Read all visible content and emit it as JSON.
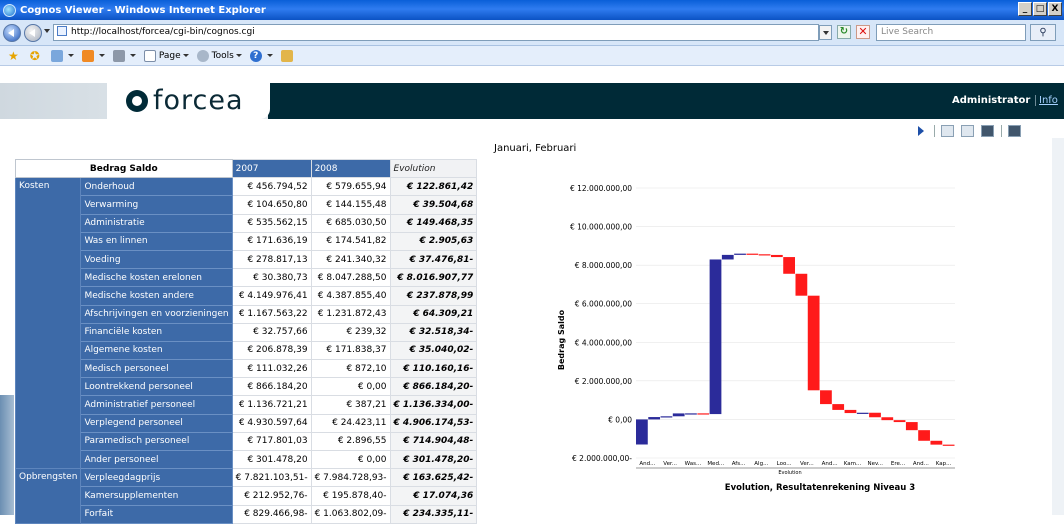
{
  "window": {
    "title": "Cognos Viewer - Windows Internet Explorer",
    "controls": [
      "_",
      "·",
      "X"
    ]
  },
  "addressbar": {
    "url": "http://localhost/forcea/cgi-bin/cognos.cgi",
    "search_placeholder": "Live Search"
  },
  "commandbar": {
    "page_label": "Page",
    "tools_label": "Tools"
  },
  "banner": {
    "logo_text": "forcea",
    "user": "Administrator",
    "info": "Info"
  },
  "report": {
    "period_title": "Januari, Februari",
    "table": {
      "corner": "Bedrag Saldo",
      "col_2007": "2007",
      "col_2008": "2008",
      "col_evolution": "Evolution",
      "groups": [
        {
          "name": "Kosten",
          "rows": [
            {
              "label": "Onderhoud",
              "v2007": "€ 456.794,52",
              "v2008": "€ 579.655,94",
              "evo": "€ 122.861,42"
            },
            {
              "label": "Verwarming",
              "v2007": "€ 104.650,80",
              "v2008": "€ 144.155,48",
              "evo": "€ 39.504,68"
            },
            {
              "label": "Administratie",
              "v2007": "€ 535.562,15",
              "v2008": "€ 685.030,50",
              "evo": "€ 149.468,35"
            },
            {
              "label": "Was en linnen",
              "v2007": "€ 171.636,19",
              "v2008": "€ 174.541,82",
              "evo": "€ 2.905,63"
            },
            {
              "label": "Voeding",
              "v2007": "€ 278.817,13",
              "v2008": "€ 241.340,32",
              "evo": "€ 37.476,81-"
            },
            {
              "label": "Medische kosten erelonen",
              "v2007": "€ 30.380,73",
              "v2008": "€ 8.047.288,50",
              "evo": "€ 8.016.907,77"
            },
            {
              "label": "Medische kosten andere",
              "v2007": "€ 4.149.976,41",
              "v2008": "€ 4.387.855,40",
              "evo": "€ 237.878,99"
            },
            {
              "label": "Afschrijvingen en voorzieningen",
              "v2007": "€ 1.167.563,22",
              "v2008": "€ 1.231.872,43",
              "evo": "€ 64.309,21"
            },
            {
              "label": "Financiële kosten",
              "v2007": "€ 32.757,66",
              "v2008": "€ 239,32",
              "evo": "€ 32.518,34-"
            },
            {
              "label": "Algemene kosten",
              "v2007": "€ 206.878,39",
              "v2008": "€ 171.838,37",
              "evo": "€ 35.040,02-"
            },
            {
              "label": "Medisch personeel",
              "v2007": "€ 111.032,26",
              "v2008": "€ 872,10",
              "evo": "€ 110.160,16-"
            },
            {
              "label": "Loontrekkend personeel",
              "v2007": "€ 866.184,20",
              "v2008": "€ 0,00",
              "evo": "€ 866.184,20-"
            },
            {
              "label": "Administratief personeel",
              "v2007": "€ 1.136.721,21",
              "v2008": "€ 387,21",
              "evo": "€ 1.136.334,00-"
            },
            {
              "label": "Verplegend personeel",
              "v2007": "€ 4.930.597,64",
              "v2008": "€ 24.423,11",
              "evo": "€ 4.906.174,53-"
            },
            {
              "label": "Paramedisch personeel",
              "v2007": "€ 717.801,03",
              "v2008": "€ 2.896,55",
              "evo": "€ 714.904,48-"
            },
            {
              "label": "Ander personeel",
              "v2007": "€ 301.478,20",
              "v2008": "€ 0,00",
              "evo": "€ 301.478,20-"
            }
          ]
        },
        {
          "name": "Opbrengsten",
          "rows": [
            {
              "label": "Verpleegdagprijs",
              "v2007": "€ 7.821.103,51-",
              "v2008": "€ 7.984.728,93-",
              "evo": "€ 163.625,42-"
            },
            {
              "label": "Kamersupplementen",
              "v2007": "€ 212.952,76-",
              "v2008": "€ 195.878,40-",
              "evo": "€ 17.074,36"
            },
            {
              "label": "Forfait",
              "v2007": "€ 829.466,98-",
              "v2008": "€ 1.063.802,09-",
              "evo": "€ 234.335,11-"
            }
          ]
        }
      ]
    }
  },
  "chart_data": {
    "type": "bar",
    "subtype": "waterfall",
    "title": "Evolution, Resultatenrekening Niveau 3",
    "ylabel": "Bedrag Saldo",
    "xlabel": "Evolution",
    "ylim": [
      -2000000,
      12000000
    ],
    "yticks": [
      "€ 2.000.000,00-",
      "€ 0,00",
      "€ 2.000.000,00",
      "€ 4.000.000,00",
      "€ 6.000.000,00",
      "€ 8.000.000,00",
      "€ 10.000.000,00",
      "€ 12.000.000,00"
    ],
    "ytick_values": [
      -2000000,
      0,
      2000000,
      4000000,
      6000000,
      8000000,
      10000000,
      12000000
    ],
    "categories": [
      "And...",
      "Ver...",
      "Was...",
      "Med...",
      "Afs...",
      "Alg...",
      "Loo...",
      "Ver...",
      "And...",
      "Kam...",
      "Nev...",
      "Ere...",
      "And...",
      "Kap..."
    ],
    "start_value": -1300000,
    "steps": [
      1300000,
      122861,
      39505,
      149468,
      2906,
      -37477,
      8016908,
      237879,
      64309,
      -32518,
      -35040,
      -110160,
      -866184,
      -1136334,
      -4906175,
      -714904,
      -301478,
      -163625,
      17074,
      -234335,
      -150000,
      -100000,
      -420000,
      -550000,
      -200000,
      -50000
    ],
    "colors": {
      "increase": "#2b2b9a",
      "decrease": "#ff1a1a"
    }
  }
}
